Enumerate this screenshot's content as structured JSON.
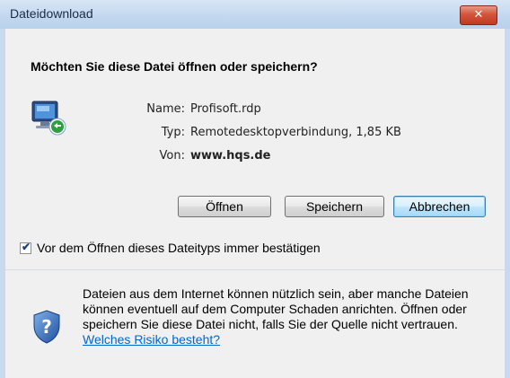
{
  "window": {
    "title": "Dateidownload",
    "close_label": "✕"
  },
  "dialog": {
    "question": "Möchten Sie diese Datei öffnen oder speichern?",
    "file_icon": "remote-desktop-icon",
    "file_info": [
      {
        "label": "Name:",
        "value": "Profisoft.rdp",
        "bold": false
      },
      {
        "label": "Typ:",
        "value": "Remotedesktopverbindung, 1,85 KB",
        "bold": false
      },
      {
        "label": "Von:",
        "value": "www.hqs.de",
        "bold": true
      }
    ],
    "buttons": {
      "open": "Öffnen",
      "save": "Speichern",
      "cancel": "Abbrechen"
    },
    "checkbox": {
      "label": "Vor dem Öffnen dieses Dateityps immer bestätigen",
      "checked": true
    },
    "warning": {
      "icon": "shield-question-icon",
      "text": "Dateien aus dem Internet können nützlich sein, aber manche Dateien können eventuell auf dem Computer Schaden anrichten. Öffnen oder speichern Sie diese Datei nicht, falls Sie der Quelle nicht vertrauen.",
      "link": "Welches Risiko besteht?"
    }
  }
}
